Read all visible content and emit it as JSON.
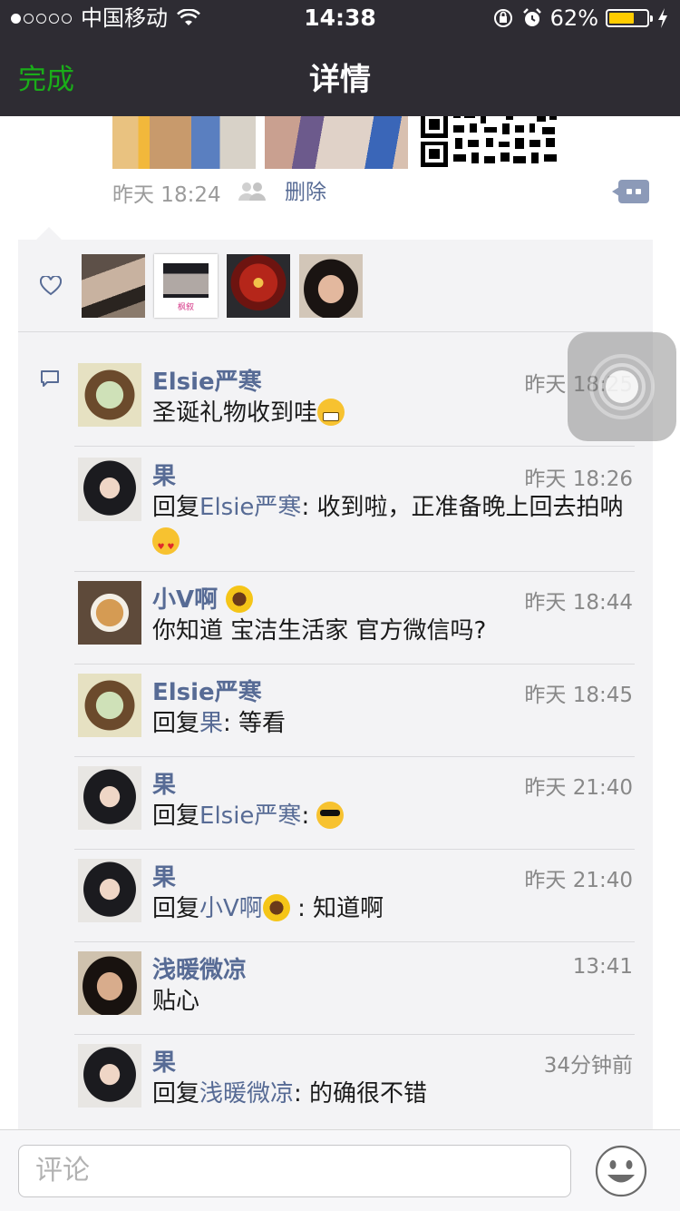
{
  "status_bar": {
    "carrier": "中国移动",
    "time": "14:38",
    "battery": "62%",
    "battery_level": 0.62,
    "signal_on": 1,
    "signal_total": 5
  },
  "nav": {
    "done_label": "完成",
    "title": "详情"
  },
  "post": {
    "time": "昨天 18:24",
    "delete_label": "删除"
  },
  "comments": [
    {
      "name": "Elsie严寒",
      "time": "昨天 18:25",
      "text": "圣诞礼物收到哇",
      "reply_to": "",
      "emoji": "grin"
    },
    {
      "name": "果",
      "time": "昨天 18:26",
      "text": ": 收到啦，正准备晚上回去拍呐",
      "reply_to": "Elsie严寒",
      "emoji": "heart-eyes"
    },
    {
      "name": "小V啊",
      "time": "昨天 18:44",
      "text": "你知道 宝洁生活家 官方微信吗?",
      "reply_to": "",
      "emoji": ""
    },
    {
      "name": "Elsie严寒",
      "time": "昨天 18:45",
      "text": ": 等看",
      "reply_to": "果",
      "emoji": ""
    },
    {
      "name": "果",
      "time": "昨天 21:40",
      "text": ": ",
      "reply_to": "Elsie严寒",
      "emoji": "sunglasses"
    },
    {
      "name": "果",
      "time": "昨天 21:40",
      "text": " : 知道啊",
      "reply_to": "小V啊",
      "emoji": ""
    },
    {
      "name": "浅暖微凉",
      "time": "13:41",
      "text": "贴心",
      "reply_to": "",
      "emoji": ""
    },
    {
      "name": "果",
      "time": "34分钟前",
      "text": ": 的确很不错",
      "reply_to": "浅暖微凉",
      "emoji": ""
    }
  ],
  "reply_word": "回复",
  "avatar_caption": "枫叙",
  "input": {
    "placeholder": "评论"
  },
  "colors": {
    "accent_green": "#1aad19",
    "link_blue": "#576b95",
    "nav_bg": "#2e2c33",
    "panel_bg": "#f3f3f5"
  },
  "icons": {
    "heart": "heart-icon",
    "comment": "chat-bubble-icon",
    "people": "people-icon",
    "more": "comment-more-icon",
    "emoji": "smiley-icon",
    "wifi": "wifi-icon",
    "alarm": "alarm-icon",
    "lock_rotation": "rotation-lock-icon",
    "charging": "charging-icon"
  }
}
